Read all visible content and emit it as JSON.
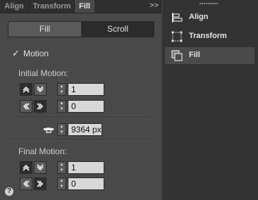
{
  "tabs": [
    {
      "label": "Align",
      "active": false
    },
    {
      "label": "Transform",
      "active": false
    },
    {
      "label": "Fill",
      "active": true
    }
  ],
  "collapse_label": ">>",
  "segmented": {
    "fill": "Fill",
    "scroll": "Scroll",
    "selected": "Fill"
  },
  "motion": {
    "label": "Motion",
    "checked": true
  },
  "initial": {
    "label": "Initial Motion:",
    "vertical": {
      "up_icon": "arrow-up-double",
      "down_icon": "arrow-down-double",
      "value": "1"
    },
    "horizontal": {
      "left_icon": "arrow-left-double",
      "right_icon": "arrow-right-double",
      "value": "0"
    }
  },
  "stop": {
    "icon": "stop-marker",
    "value": "9364 px"
  },
  "final": {
    "label": "Final Motion:",
    "vertical": {
      "up_icon": "arrow-up-double",
      "down_icon": "arrow-down-double",
      "value": "1"
    },
    "horizontal": {
      "left_icon": "arrow-left-double",
      "right_icon": "arrow-right-double",
      "value": "0"
    }
  },
  "help_label": "?",
  "right_panel": {
    "items": [
      {
        "label": "Align",
        "icon": "align-icon",
        "active": false
      },
      {
        "label": "Transform",
        "icon": "transform-icon",
        "active": false
      },
      {
        "label": "Fill",
        "icon": "fill-icon",
        "active": true
      }
    ]
  },
  "colors": {
    "panel": "#494949",
    "tabbar": "#2f2f2f",
    "field": "#d8d8d8",
    "accent_text": "#e0e0e0"
  }
}
